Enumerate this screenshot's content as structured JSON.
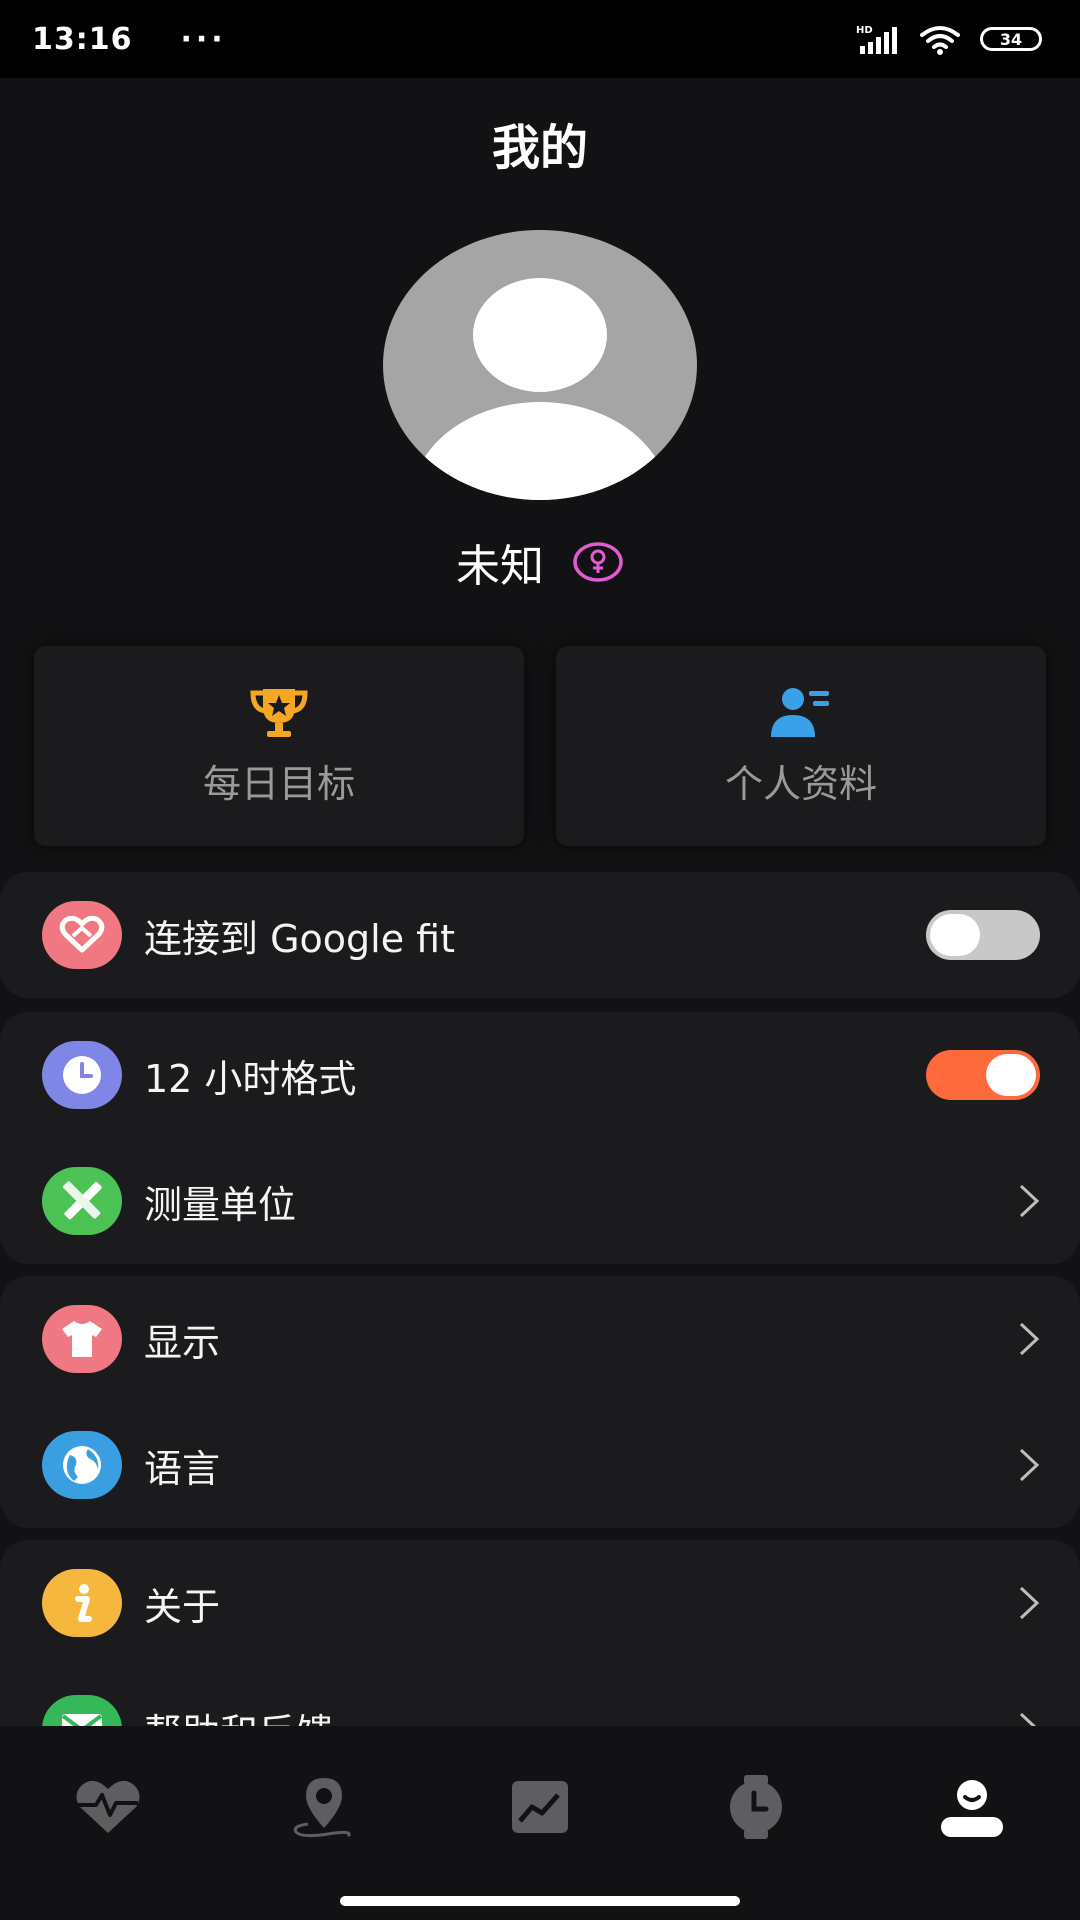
{
  "status_bar": {
    "time": "13:16",
    "dots": "···",
    "battery": "34"
  },
  "header": {
    "title": "我的"
  },
  "profile": {
    "name": "未知",
    "gender_icon": "female-icon"
  },
  "cards": [
    {
      "label": "每日目标",
      "icon": "trophy-icon",
      "icon_color": "#f5a623"
    },
    {
      "label": "个人资料",
      "icon": "profile-card-icon",
      "icon_color": "#3aa0e8"
    }
  ],
  "settings": {
    "google_fit": {
      "label": "连接到 Google fit",
      "enabled": false,
      "icon_color": "#f07882"
    },
    "hour12": {
      "label": "12 小时格式",
      "enabled": true,
      "icon_color": "#7f86e6"
    },
    "units": {
      "label": "测量单位",
      "icon_color": "#4cc254"
    },
    "display": {
      "label": "显示",
      "icon_color": "#f07882"
    },
    "language": {
      "label": "语言",
      "icon_color": "#3a9fe0"
    },
    "about": {
      "label": "关于",
      "icon_color": "#f5b73d"
    },
    "help": {
      "label": "帮助和反馈",
      "icon_color": "#34b85a"
    }
  },
  "colors": {
    "accent": "#ff6a3d",
    "toggle_off": "#c8c8c8",
    "background": "#121214"
  },
  "bottom_nav": [
    {
      "icon": "heart-rate-icon",
      "active": false
    },
    {
      "icon": "location-route-icon",
      "active": false
    },
    {
      "icon": "trend-chart-icon",
      "active": false
    },
    {
      "icon": "watch-icon",
      "active": false
    },
    {
      "icon": "user-icon",
      "active": true
    }
  ]
}
